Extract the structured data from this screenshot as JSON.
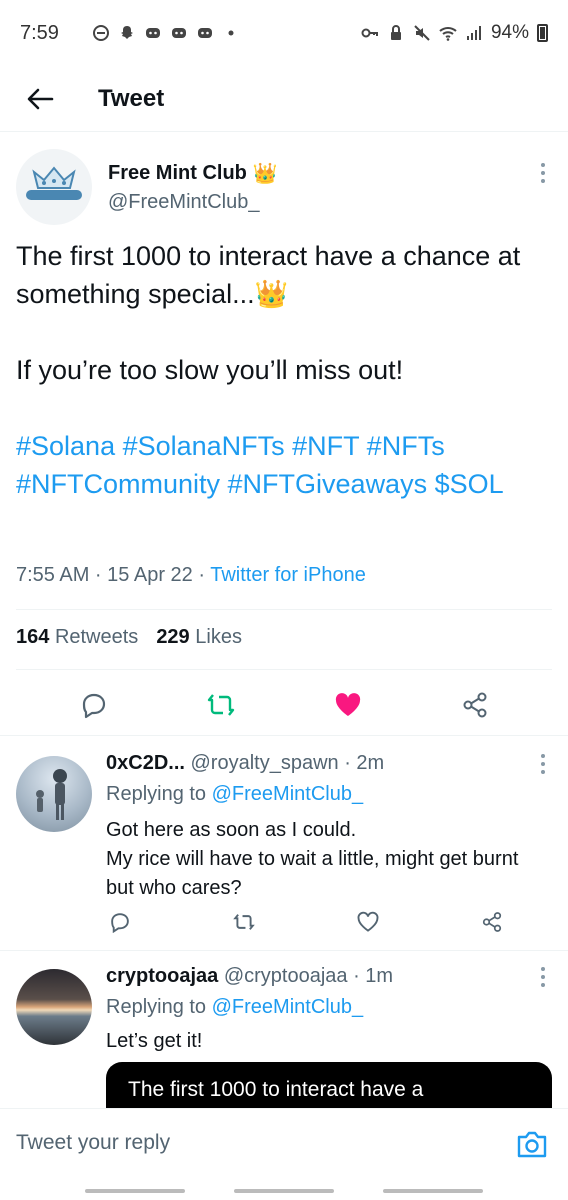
{
  "status_bar": {
    "time": "7:59",
    "battery": "94%"
  },
  "app_bar": {
    "title": "Tweet"
  },
  "tweet": {
    "author_name": "Free Mint Club",
    "author_emoji": "👑",
    "author_handle": "@FreeMintClub_",
    "avatar_label": "FREE MINT CLUB",
    "text_line1": "The first 1000 to interact have a chance at something special...",
    "text_emoji": "👑",
    "text_line2": "If you’re too slow you’ll miss out!",
    "hashtags": "#Solana #SolanaNFTs #NFT #NFTs #NFTCommunity #NFTGiveaways $SOL",
    "timestamp": "7:55 AM · 15 Apr 22 · ",
    "client": "Twitter for iPhone",
    "retweets_count": "164",
    "retweets_label": "Retweets",
    "likes_count": "229",
    "likes_label": "Likes",
    "colors": {
      "accent": "#1d9bf0",
      "retweet": "#00ba7c",
      "like": "#f91880"
    }
  },
  "replies": [
    {
      "name": "0xC2D...",
      "handle": "@royalty_spawn",
      "time": " · 2m",
      "replying_prefix": "Replying to ",
      "replying_to": "@FreeMintClub_",
      "text_line1": "Got here as soon as I could.",
      "text_line2": "My rice will have to wait a little, might get burnt but who cares?"
    },
    {
      "name": "cryptooajaa",
      "handle": "@cryptooajaa",
      "time": " · 1m",
      "replying_prefix": "Replying to ",
      "replying_to": "@FreeMintClub_",
      "text_line1": "Let’s get it!",
      "quoted_text": "The first 1000 to interact have a"
    }
  ],
  "reply_bar": {
    "placeholder": "Tweet your reply"
  }
}
